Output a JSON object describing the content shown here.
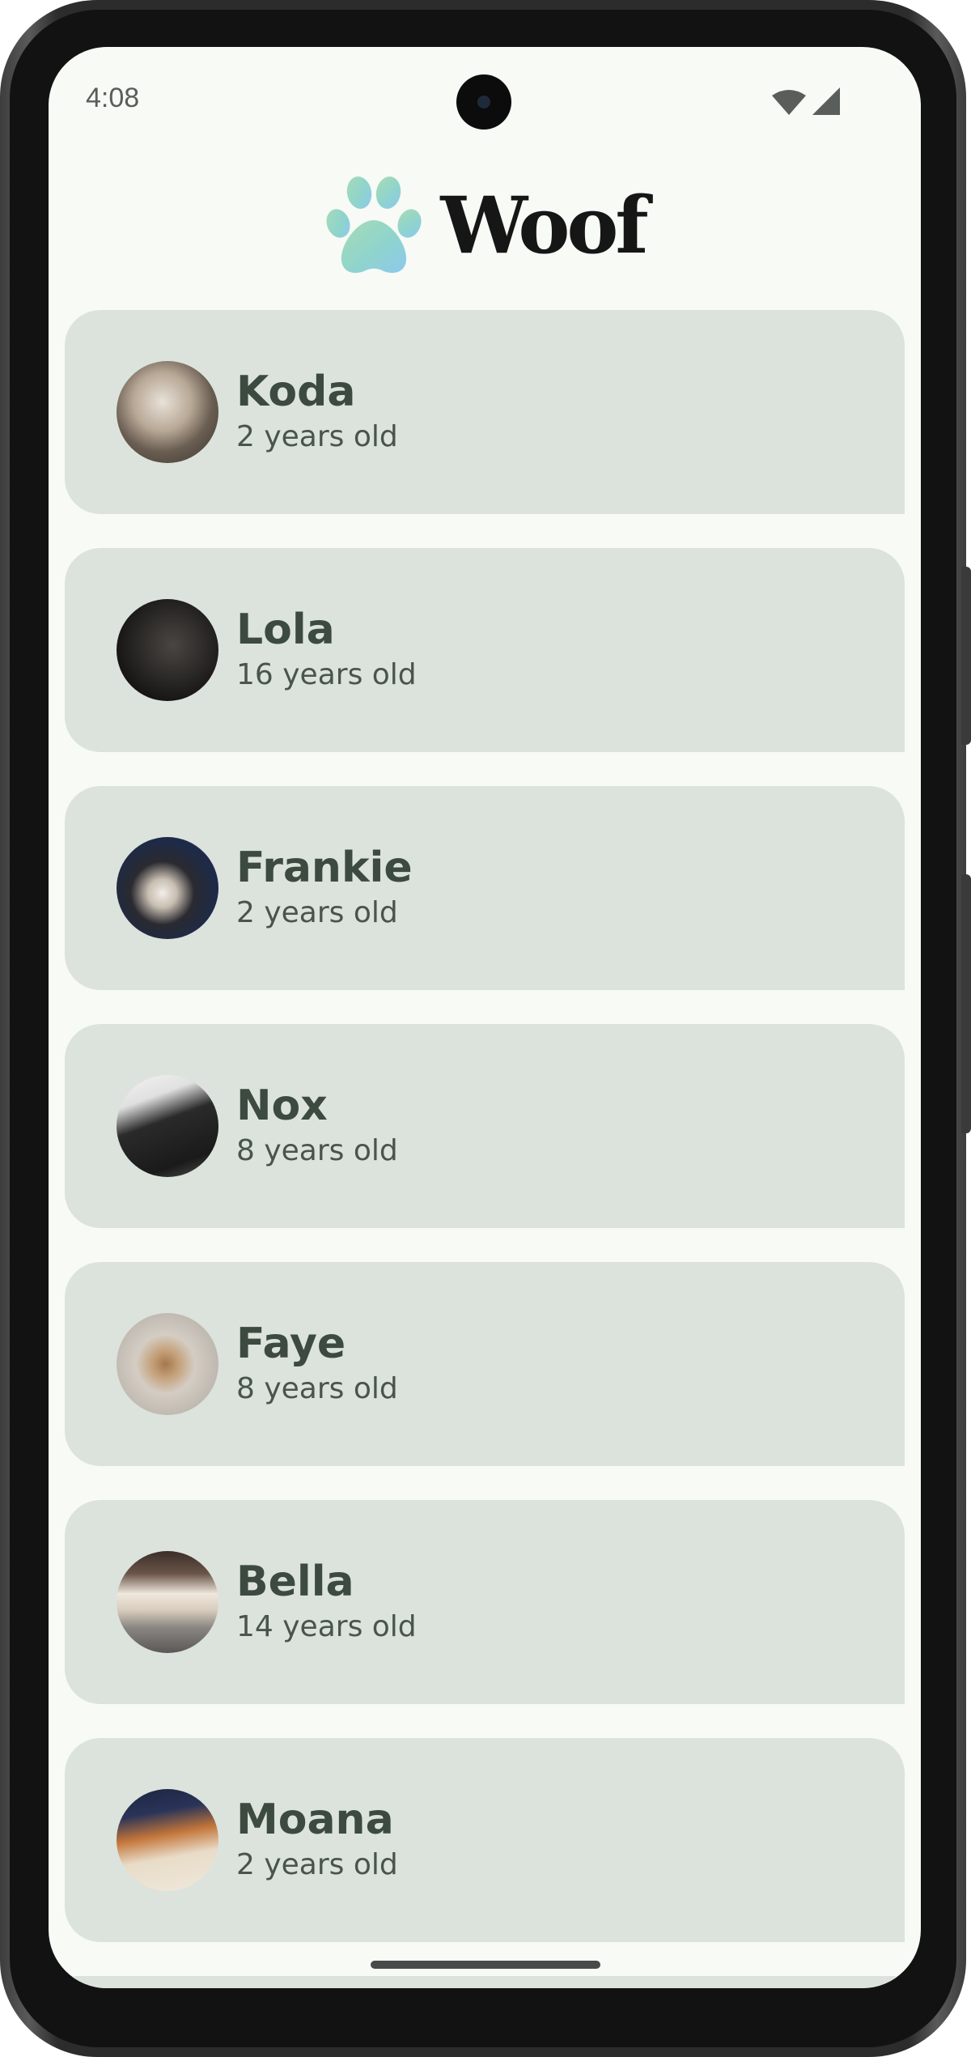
{
  "status_bar": {
    "time": "4:08"
  },
  "app_bar": {
    "title": "Woof",
    "logo_icon": "paw-icon"
  },
  "dogs": [
    {
      "name": "Koda",
      "age": "2 years old"
    },
    {
      "name": "Lola",
      "age": "16 years old"
    },
    {
      "name": "Frankie",
      "age": "2 years old"
    },
    {
      "name": "Nox",
      "age": "8 years old"
    },
    {
      "name": "Faye",
      "age": "8 years old"
    },
    {
      "name": "Bella",
      "age": "14 years old"
    },
    {
      "name": "Moana",
      "age": "2 years old"
    }
  ],
  "colors": {
    "background": "#f7faf5",
    "card": "#dbe3dc",
    "name_text": "#3d4a40",
    "age_text": "#4a544d",
    "title_text": "#161616"
  }
}
